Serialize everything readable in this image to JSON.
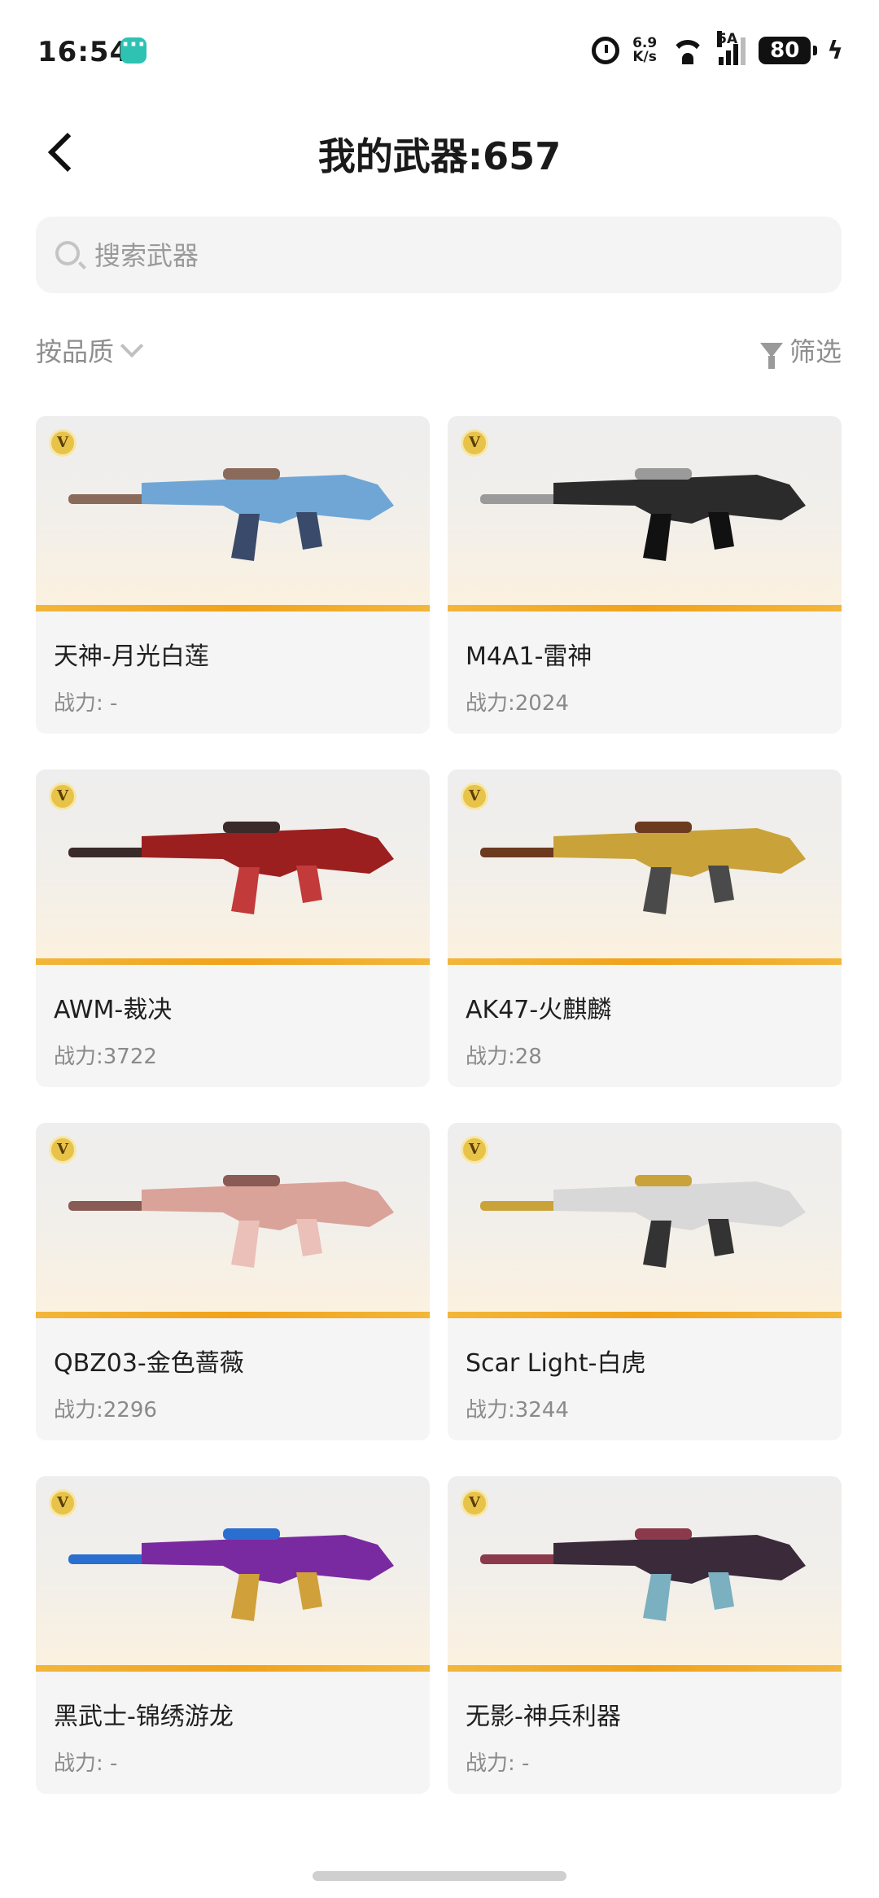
{
  "status_bar": {
    "time": "16:54",
    "net_speed_value": "6.9",
    "net_speed_unit": "K/s",
    "signal_label": "5A",
    "battery": "80"
  },
  "header": {
    "title": "我的武器:657"
  },
  "search": {
    "placeholder": "搜索武器"
  },
  "controls": {
    "sort_label": "按品质",
    "filter_label": "筛选"
  },
  "weapons": [
    {
      "name": "天神-月光白莲",
      "power": "战力: -",
      "badge": "V",
      "colors": [
        "#6fa6d6",
        "#8a6b5b",
        "#3a4a6a"
      ]
    },
    {
      "name": "M4A1-雷神",
      "power": "战力:2024",
      "badge": "V",
      "colors": [
        "#2b2b2b",
        "#9a9a9a",
        "#111111"
      ]
    },
    {
      "name": "AWM-裁决",
      "power": "战力:3722",
      "badge": "V",
      "colors": [
        "#9c1f1f",
        "#3a2a2a",
        "#c23a3a"
      ]
    },
    {
      "name": "AK47-火麒麟",
      "power": "战力:28",
      "badge": "V",
      "colors": [
        "#c9a33a",
        "#6b3a1f",
        "#4a4a4a"
      ]
    },
    {
      "name": "QBZ03-金色蔷薇",
      "power": "战力:2296",
      "badge": "V",
      "colors": [
        "#d9a39a",
        "#8a5a55",
        "#eac0b8"
      ]
    },
    {
      "name": "Scar Light-白虎",
      "power": "战力:3244",
      "badge": "V",
      "colors": [
        "#d8d8d8",
        "#caa23a",
        "#333333"
      ]
    },
    {
      "name": "黑武士-锦绣游龙",
      "power": "战力: -",
      "badge": "V",
      "colors": [
        "#7a2aa0",
        "#2a6fd0",
        "#d0a03a"
      ]
    },
    {
      "name": "无影-神兵利器",
      "power": "战力: -",
      "badge": "V",
      "colors": [
        "#3a2a3a",
        "#8a3a4a",
        "#7ab0c0"
      ]
    }
  ]
}
